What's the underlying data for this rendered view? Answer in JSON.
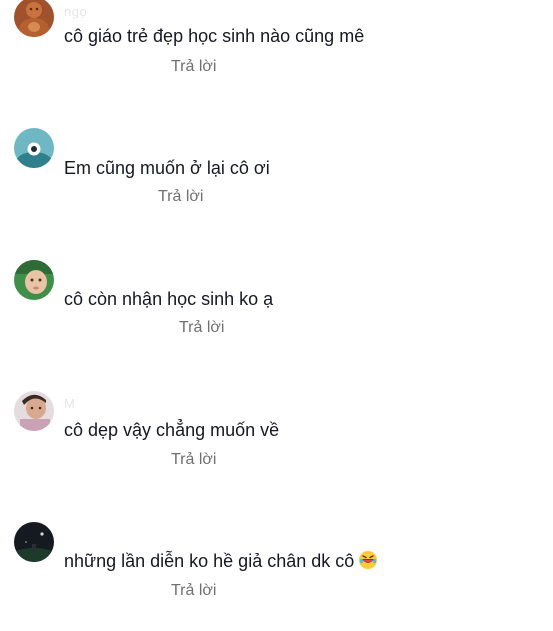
{
  "comments": [
    {
      "username": "ngọ",
      "text": "cô giáo trẻ đẹp học sinh nào cũng mê",
      "date": "",
      "reply_label": "Trả lời",
      "avatar_icon": "buddha-figure-avatar"
    },
    {
      "username": "",
      "text": "Em cũng muốn ở lại cô ơi",
      "date": "",
      "reply_label": "Trả lời",
      "avatar_icon": "cartoon-mascot-avatar"
    },
    {
      "username": "",
      "text": "cô còn nhận học sinh ko ạ",
      "date": "",
      "reply_label": "Trả lời",
      "avatar_icon": "baby-photo-avatar"
    },
    {
      "username": "M",
      "text": "cô dẹp vậy chẳng muốn về",
      "date": "",
      "reply_label": "Trả lời",
      "avatar_icon": "child-photo-avatar"
    },
    {
      "username": "",
      "text": "những lần diễn ko hề giả chân dk cô",
      "date": "",
      "reply_label": "Trả lời",
      "avatar_icon": "dark-night-avatar",
      "emoji_icon": "rolling-laughing-emoji"
    }
  ]
}
